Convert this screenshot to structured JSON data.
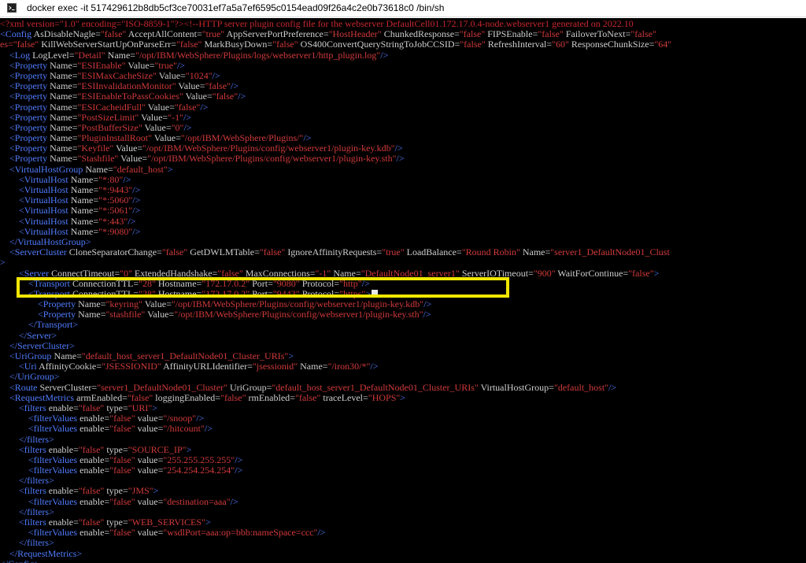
{
  "window": {
    "title": "docker exec -it 517429612b8db5cf3ce70031ef7a5a7ef6595c0154ead09f26a4c2e0b73618c0 /bin/sh",
    "icon": "terminal-icon"
  },
  "colors": {
    "tag": "#4f7dff",
    "attribute": "#cfcfcf",
    "value": "#d23a3a",
    "highlight": "#f2e700",
    "background": "#000000"
  },
  "terminal": {
    "lines": [
      [
        [
          "r",
          "<?xml version=\"1.0\" encoding=\"ISO-8859-1\"?><!--HTTP server plugin config file for the webserver DefaultCell01.172.17.0.4-node.webserver1 generated on 2022.10"
        ]
      ],
      [
        [
          "b",
          "<Config "
        ],
        [
          "a",
          "AsDisableNagle="
        ],
        [
          "v",
          "\"false\""
        ],
        [
          "a",
          " AcceptAllContent="
        ],
        [
          "v",
          "\"true\""
        ],
        [
          "a",
          " AppServerPortPreference="
        ],
        [
          "v",
          "\"HostHeader\""
        ],
        [
          "a",
          " ChunkedResponse="
        ],
        [
          "v",
          "\"false\""
        ],
        [
          "a",
          " FIPSEnable="
        ],
        [
          "v",
          "\"false\""
        ],
        [
          "a",
          " FailoverToNext="
        ],
        [
          "v",
          "\"false\""
        ]
      ],
      [
        [
          "v",
          "es=\"false\""
        ],
        [
          "a",
          " KillWebServerStartUpOnParseErr="
        ],
        [
          "v",
          "\"false\""
        ],
        [
          "a",
          " MarkBusyDown="
        ],
        [
          "v",
          "\"false\""
        ],
        [
          "a",
          " OS400ConvertQueryStringToJobCCSID="
        ],
        [
          "v",
          "\"false\""
        ],
        [
          "a",
          " RefreshInterval="
        ],
        [
          "v",
          "\"60\""
        ],
        [
          "a",
          " ResponseChunkSize="
        ],
        [
          "v",
          "\"64\""
        ]
      ],
      [
        [
          "b",
          "    <Log "
        ],
        [
          "a",
          "LogLevel="
        ],
        [
          "v",
          "\"Detail\""
        ],
        [
          "a",
          " Name="
        ],
        [
          "v",
          "\"/opt/IBM/WebSphere/Plugins/logs/webserver1/http_plugin.log\""
        ],
        [
          "b",
          "/>"
        ]
      ],
      [
        [
          "b",
          "    <Property "
        ],
        [
          "a",
          "Name="
        ],
        [
          "v",
          "\"ESIEnable\""
        ],
        [
          "a",
          " Value="
        ],
        [
          "v",
          "\"true\""
        ],
        [
          "b",
          "/>"
        ]
      ],
      [
        [
          "b",
          "    <Property "
        ],
        [
          "a",
          "Name="
        ],
        [
          "v",
          "\"ESIMaxCacheSize\""
        ],
        [
          "a",
          " Value="
        ],
        [
          "v",
          "\"1024\""
        ],
        [
          "b",
          "/>"
        ]
      ],
      [
        [
          "b",
          "    <Property "
        ],
        [
          "a",
          "Name="
        ],
        [
          "v",
          "\"ESIInvalidationMonitor\""
        ],
        [
          "a",
          " Value="
        ],
        [
          "v",
          "\"false\""
        ],
        [
          "b",
          "/>"
        ]
      ],
      [
        [
          "b",
          "    <Property "
        ],
        [
          "a",
          "Name="
        ],
        [
          "v",
          "\"ESIEnableToPassCookies\""
        ],
        [
          "a",
          " Value="
        ],
        [
          "v",
          "\"false\""
        ],
        [
          "b",
          "/>"
        ]
      ],
      [
        [
          "b",
          "    <Property "
        ],
        [
          "a",
          "Name="
        ],
        [
          "v",
          "\"ESICacheidFull\""
        ],
        [
          "a",
          " Value="
        ],
        [
          "v",
          "\"false\""
        ],
        [
          "b",
          "/>"
        ]
      ],
      [
        [
          "b",
          "    <Property "
        ],
        [
          "a",
          "Name="
        ],
        [
          "v",
          "\"PostSizeLimit\""
        ],
        [
          "a",
          " Value="
        ],
        [
          "v",
          "\"-1\""
        ],
        [
          "b",
          "/>"
        ]
      ],
      [
        [
          "b",
          "    <Property "
        ],
        [
          "a",
          "Name="
        ],
        [
          "v",
          "\"PostBufferSize\""
        ],
        [
          "a",
          " Value="
        ],
        [
          "v",
          "\"0\""
        ],
        [
          "b",
          "/>"
        ]
      ],
      [
        [
          "b",
          "    <Property "
        ],
        [
          "a",
          "Name="
        ],
        [
          "v",
          "\"PluginInstallRoot\""
        ],
        [
          "a",
          " Value="
        ],
        [
          "v",
          "\"/opt/IBM/WebSphere/Plugins/\""
        ],
        [
          "b",
          "/>"
        ]
      ],
      [
        [
          "b",
          "    <Property "
        ],
        [
          "a",
          "Name="
        ],
        [
          "v",
          "\"Keyfile\""
        ],
        [
          "a",
          " Value="
        ],
        [
          "v",
          "\"/opt/IBM/WebSphere/Plugins/config/webserver1/plugin-key.kdb\""
        ],
        [
          "b",
          "/>"
        ]
      ],
      [
        [
          "b",
          "    <Property "
        ],
        [
          "a",
          "Name="
        ],
        [
          "v",
          "\"Stashfile\""
        ],
        [
          "a",
          " Value="
        ],
        [
          "v",
          "\"/opt/IBM/WebSphere/Plugins/config/webserver1/plugin-key.sth\""
        ],
        [
          "b",
          "/>"
        ]
      ],
      [
        [
          "b",
          "    <VirtualHostGroup "
        ],
        [
          "a",
          "Name="
        ],
        [
          "v",
          "\"default_host\""
        ],
        [
          "b",
          ">"
        ]
      ],
      [
        [
          "b",
          "        <VirtualHost "
        ],
        [
          "a",
          "Name="
        ],
        [
          "v",
          "\"*:80\""
        ],
        [
          "b",
          "/>"
        ]
      ],
      [
        [
          "b",
          "        <VirtualHost "
        ],
        [
          "a",
          "Name="
        ],
        [
          "v",
          "\"*:9443\""
        ],
        [
          "b",
          "/>"
        ]
      ],
      [
        [
          "b",
          "        <VirtualHost "
        ],
        [
          "a",
          "Name="
        ],
        [
          "v",
          "\"*:5060\""
        ],
        [
          "b",
          "/>"
        ]
      ],
      [
        [
          "b",
          "        <VirtualHost "
        ],
        [
          "a",
          "Name="
        ],
        [
          "v",
          "\"*:5061\""
        ],
        [
          "b",
          "/>"
        ]
      ],
      [
        [
          "b",
          "        <VirtualHost "
        ],
        [
          "a",
          "Name="
        ],
        [
          "v",
          "\"*:443\""
        ],
        [
          "b",
          "/>"
        ]
      ],
      [
        [
          "b",
          "        <VirtualHost "
        ],
        [
          "a",
          "Name="
        ],
        [
          "v",
          "\"*:9080\""
        ],
        [
          "b",
          "/>"
        ]
      ],
      [
        [
          "b",
          "    </VirtualHostGroup>"
        ]
      ],
      [
        [
          "b",
          "    <ServerCluster "
        ],
        [
          "a",
          "CloneSeparatorChange="
        ],
        [
          "v",
          "\"false\""
        ],
        [
          "a",
          " GetDWLMTable="
        ],
        [
          "v",
          "\"false\""
        ],
        [
          "a",
          " IgnoreAffinityRequests="
        ],
        [
          "v",
          "\"true\""
        ],
        [
          "a",
          " LoadBalance="
        ],
        [
          "v",
          "\"Round Robin\""
        ],
        [
          "a",
          " Name="
        ],
        [
          "v",
          "\"server1_DefaultNode01_Clust"
        ]
      ],
      [
        [
          "b",
          ">"
        ]
      ],
      [
        [
          "b",
          "        <Server "
        ],
        [
          "a",
          "ConnectTimeout="
        ],
        [
          "v",
          "\"0\""
        ],
        [
          "a",
          " ExtendedHandshake="
        ],
        [
          "v",
          "\"false\""
        ],
        [
          "a",
          " MaxConnections="
        ],
        [
          "v",
          "\"-1\""
        ],
        [
          "a",
          " Name="
        ],
        [
          "v",
          "\"DefaultNode01_server1\""
        ],
        [
          "a",
          " ServerIOTimeout="
        ],
        [
          "v",
          "\"900\""
        ],
        [
          "a",
          " WaitForContinue="
        ],
        [
          "v",
          "\"false\""
        ],
        [
          "b",
          ">"
        ]
      ],
      [
        [
          "b",
          "            <Transport "
        ],
        [
          "a",
          "ConnectionTTL="
        ],
        [
          "v",
          "\"28\""
        ],
        [
          "a",
          " Hostname="
        ],
        [
          "v",
          "\"172.17.0.2\""
        ],
        [
          "a",
          " Port="
        ],
        [
          "v",
          "\"9080\""
        ],
        [
          "a",
          " Protocol="
        ],
        [
          "v",
          "\"http\""
        ],
        [
          "b",
          "/>"
        ]
      ],
      [
        [
          "b",
          "            <Transport "
        ],
        [
          "a",
          "ConnectionTTL="
        ],
        [
          "v",
          "\"28\""
        ],
        [
          "a",
          " Hostname="
        ],
        [
          "v",
          "\"172.17.0.2\""
        ],
        [
          "a",
          " Port="
        ],
        [
          "v",
          "\"9443\""
        ],
        [
          "a",
          " Protocol="
        ],
        [
          "v",
          "\"https\""
        ],
        [
          "b",
          ">"
        ]
      ],
      [
        [
          "b",
          "                <Property "
        ],
        [
          "a",
          "Name="
        ],
        [
          "v",
          "\"keyring\""
        ],
        [
          "a",
          " Value="
        ],
        [
          "v",
          "\"/opt/IBM/WebSphere/Plugins/config/webserver1/plugin-key.kdb\""
        ],
        [
          "b",
          "/>"
        ]
      ],
      [
        [
          "b",
          "                <Property "
        ],
        [
          "a",
          "Name="
        ],
        [
          "v",
          "\"stashfile\""
        ],
        [
          "a",
          " Value="
        ],
        [
          "v",
          "\"/opt/IBM/WebSphere/Plugins/config/webserver1/plugin-key.sth\""
        ],
        [
          "b",
          "/>"
        ]
      ],
      [
        [
          "b",
          "            </Transport>"
        ]
      ],
      [
        [
          "b",
          "        </Server>"
        ]
      ],
      [
        [
          "b",
          "    </ServerCluster>"
        ]
      ],
      [
        [
          "b",
          "    <UriGroup "
        ],
        [
          "a",
          "Name="
        ],
        [
          "v",
          "\"default_host_server1_DefaultNode01_Cluster_URIs\""
        ],
        [
          "b",
          ">"
        ]
      ],
      [
        [
          "b",
          "        <Uri "
        ],
        [
          "a",
          "AffinityCookie="
        ],
        [
          "v",
          "\"JSESSIONID\""
        ],
        [
          "a",
          " AffinityURLIdentifier="
        ],
        [
          "v",
          "\"jsessionid\""
        ],
        [
          "a",
          " Name="
        ],
        [
          "v",
          "\"/iron30/*\""
        ],
        [
          "b",
          "/>"
        ]
      ],
      [
        [
          "b",
          "    </UriGroup>"
        ]
      ],
      [
        [
          "b",
          "    <Route "
        ],
        [
          "a",
          "ServerCluster="
        ],
        [
          "v",
          "\"server1_DefaultNode01_Cluster\""
        ],
        [
          "a",
          " UriGroup="
        ],
        [
          "v",
          "\"default_host_server1_DefaultNode01_Cluster_URIs\""
        ],
        [
          "a",
          " VirtualHostGroup="
        ],
        [
          "v",
          "\"default_host\""
        ],
        [
          "b",
          "/>"
        ]
      ],
      [
        [
          "b",
          "    <RequestMetrics "
        ],
        [
          "a",
          "armEnabled="
        ],
        [
          "v",
          "\"false\""
        ],
        [
          "a",
          " loggingEnabled="
        ],
        [
          "v",
          "\"false\""
        ],
        [
          "a",
          " rmEnabled="
        ],
        [
          "v",
          "\"false\""
        ],
        [
          "a",
          " traceLevel="
        ],
        [
          "v",
          "\"HOPS\""
        ],
        [
          "b",
          ">"
        ]
      ],
      [
        [
          "b",
          "        <filters "
        ],
        [
          "a",
          "enable="
        ],
        [
          "v",
          "\"false\""
        ],
        [
          "a",
          " type="
        ],
        [
          "v",
          "\"URI\""
        ],
        [
          "b",
          ">"
        ]
      ],
      [
        [
          "b",
          "            <filterValues "
        ],
        [
          "a",
          "enable="
        ],
        [
          "v",
          "\"false\""
        ],
        [
          "a",
          " value="
        ],
        [
          "v",
          "\"/snoop\""
        ],
        [
          "b",
          "/>"
        ]
      ],
      [
        [
          "b",
          "            <filterValues "
        ],
        [
          "a",
          "enable="
        ],
        [
          "v",
          "\"false\""
        ],
        [
          "a",
          " value="
        ],
        [
          "v",
          "\"/hitcount\""
        ],
        [
          "b",
          "/>"
        ]
      ],
      [
        [
          "b",
          "        </filters>"
        ]
      ],
      [
        [
          "b",
          "        <filters "
        ],
        [
          "a",
          "enable="
        ],
        [
          "v",
          "\"false\""
        ],
        [
          "a",
          " type="
        ],
        [
          "v",
          "\"SOURCE_IP\""
        ],
        [
          "b",
          ">"
        ]
      ],
      [
        [
          "b",
          "            <filterValues "
        ],
        [
          "a",
          "enable="
        ],
        [
          "v",
          "\"false\""
        ],
        [
          "a",
          " value="
        ],
        [
          "v",
          "\"255.255.255.255\""
        ],
        [
          "b",
          "/>"
        ]
      ],
      [
        [
          "b",
          "            <filterValues "
        ],
        [
          "a",
          "enable="
        ],
        [
          "v",
          "\"false\""
        ],
        [
          "a",
          " value="
        ],
        [
          "v",
          "\"254.254.254.254\""
        ],
        [
          "b",
          "/>"
        ]
      ],
      [
        [
          "b",
          "        </filters>"
        ]
      ],
      [
        [
          "b",
          "        <filters "
        ],
        [
          "a",
          "enable="
        ],
        [
          "v",
          "\"false\""
        ],
        [
          "a",
          " type="
        ],
        [
          "v",
          "\"JMS\""
        ],
        [
          "b",
          ">"
        ]
      ],
      [
        [
          "b",
          "            <filterValues "
        ],
        [
          "a",
          "enable="
        ],
        [
          "v",
          "\"false\""
        ],
        [
          "a",
          " value="
        ],
        [
          "v",
          "\"destination=aaa\""
        ],
        [
          "b",
          "/>"
        ]
      ],
      [
        [
          "b",
          "        </filters>"
        ]
      ],
      [
        [
          "b",
          "        <filters "
        ],
        [
          "a",
          "enable="
        ],
        [
          "v",
          "\"false\""
        ],
        [
          "a",
          " type="
        ],
        [
          "v",
          "\"WEB_SERVICES\""
        ],
        [
          "b",
          ">"
        ]
      ],
      [
        [
          "b",
          "            <filterValues "
        ],
        [
          "a",
          "enable="
        ],
        [
          "v",
          "\"false\""
        ],
        [
          "a",
          " value="
        ],
        [
          "v",
          "\"wsdlPort=aaa:op=bbb:nameSpace=ccc\""
        ],
        [
          "b",
          "/>"
        ]
      ],
      [
        [
          "b",
          "        </filters>"
        ]
      ],
      [
        [
          "b",
          "    </RequestMetrics>"
        ]
      ],
      [
        [
          "b",
          "</Config>"
        ]
      ]
    ]
  }
}
